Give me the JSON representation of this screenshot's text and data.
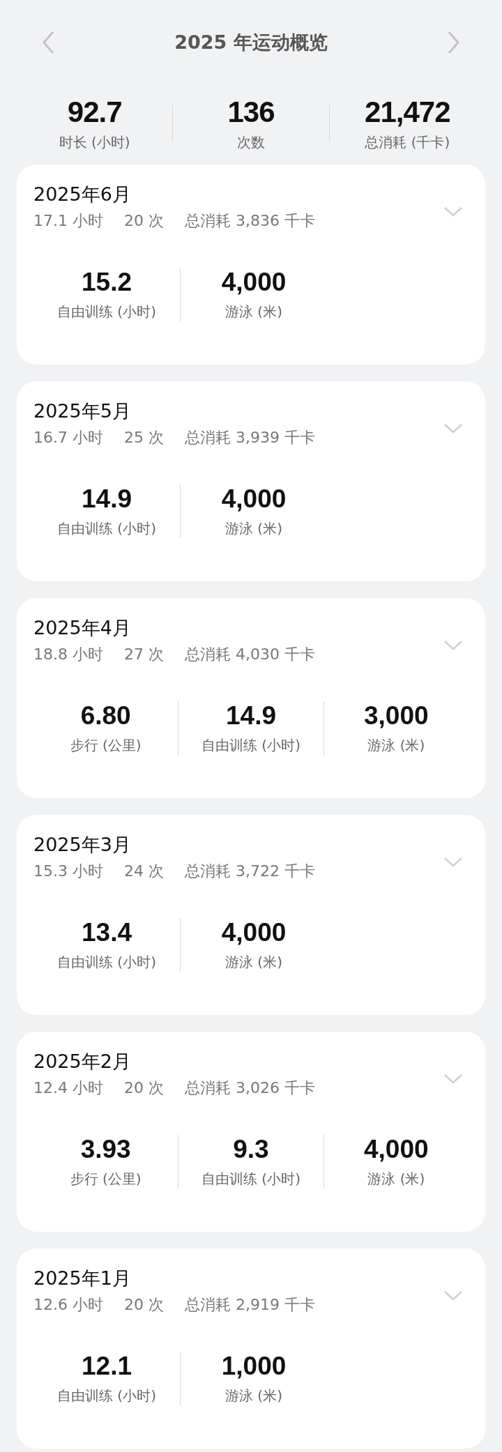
{
  "header": {
    "title": "2025 年运动概览"
  },
  "totals": [
    {
      "value": "92.7",
      "label": "时长 (小时)"
    },
    {
      "value": "136",
      "label": "次数"
    },
    {
      "value": "21,472",
      "label": "总消耗 (千卡)"
    }
  ],
  "months": [
    {
      "title": "2025年6月",
      "summary": [
        "17.1 小时",
        "20 次",
        "总消耗 3,836 千卡"
      ],
      "metrics": [
        {
          "value": "15.2",
          "label": "自由训练 (小时)"
        },
        {
          "value": "4,000",
          "label": "游泳 (米)"
        }
      ]
    },
    {
      "title": "2025年5月",
      "summary": [
        "16.7 小时",
        "25 次",
        "总消耗 3,939 千卡"
      ],
      "metrics": [
        {
          "value": "14.9",
          "label": "自由训练 (小时)"
        },
        {
          "value": "4,000",
          "label": "游泳 (米)"
        }
      ]
    },
    {
      "title": "2025年4月",
      "summary": [
        "18.8 小时",
        "27 次",
        "总消耗 4,030 千卡"
      ],
      "metrics": [
        {
          "value": "6.80",
          "label": "步行 (公里)"
        },
        {
          "value": "14.9",
          "label": "自由训练 (小时)"
        },
        {
          "value": "3,000",
          "label": "游泳 (米)"
        }
      ]
    },
    {
      "title": "2025年3月",
      "summary": [
        "15.3 小时",
        "24 次",
        "总消耗 3,722 千卡"
      ],
      "metrics": [
        {
          "value": "13.4",
          "label": "自由训练 (小时)"
        },
        {
          "value": "4,000",
          "label": "游泳 (米)"
        }
      ]
    },
    {
      "title": "2025年2月",
      "summary": [
        "12.4 小时",
        "20 次",
        "总消耗 3,026 千卡"
      ],
      "metrics": [
        {
          "value": "3.93",
          "label": "步行 (公里)"
        },
        {
          "value": "9.3",
          "label": "自由训练 (小时)"
        },
        {
          "value": "4,000",
          "label": "游泳 (米)"
        }
      ]
    },
    {
      "title": "2025年1月",
      "summary": [
        "12.6 小时",
        "20 次",
        "总消耗 2,919 千卡"
      ],
      "metrics": [
        {
          "value": "12.1",
          "label": "自由训练 (小时)"
        },
        {
          "value": "1,000",
          "label": "游泳 (米)"
        }
      ]
    }
  ]
}
